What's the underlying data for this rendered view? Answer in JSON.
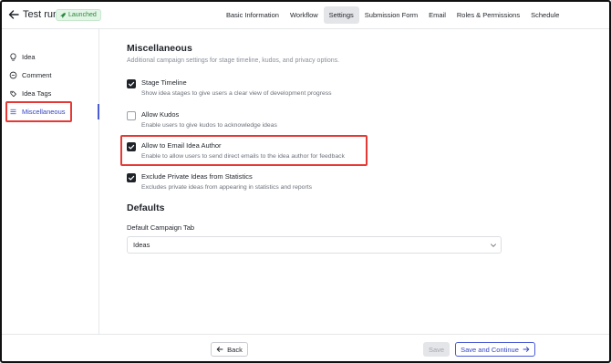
{
  "header": {
    "title": "Test run",
    "badge": "Launched",
    "tabs": [
      {
        "label": "Basic Information",
        "active": false
      },
      {
        "label": "Workflow",
        "active": false
      },
      {
        "label": "Settings",
        "active": true
      },
      {
        "label": "Submission Form",
        "active": false
      },
      {
        "label": "Email",
        "active": false
      },
      {
        "label": "Roles & Permissions",
        "active": false
      },
      {
        "label": "Schedule",
        "active": false
      }
    ]
  },
  "sidebar": {
    "items": [
      {
        "label": "Idea",
        "icon": "bulb-icon"
      },
      {
        "label": "Comment",
        "icon": "comment-icon"
      },
      {
        "label": "Idea Tags",
        "icon": "tag-icon"
      },
      {
        "label": "Miscellaneous",
        "icon": "list-icon",
        "active": true
      }
    ]
  },
  "main": {
    "title": "Miscellaneous",
    "subtitle": "Additional campaign settings for stage timeline, kudos, and privacy options.",
    "options": [
      {
        "title": "Stage Timeline",
        "desc": "Show idea stages to give users a clear view of development progress",
        "checked": true
      },
      {
        "title": "Allow Kudos",
        "desc": "Enable users to give kudos to acknowledge ideas",
        "checked": false
      },
      {
        "title": "Allow to Email Idea Author",
        "desc": "Enable to allow users to send direct emails to the idea author for feedback",
        "checked": true
      },
      {
        "title": "Exclude Private Ideas from Statistics",
        "desc": "Excludes private ideas from appearing in statistics and reports",
        "checked": true
      }
    ],
    "defaults_title": "Defaults",
    "default_tab_label": "Default Campaign Tab",
    "default_tab_value": "Ideas"
  },
  "footer": {
    "back": "Back",
    "save": "Save",
    "continue": "Save and Continue"
  },
  "colors": {
    "accent": "#3345c4",
    "highlight": "#e53935",
    "badge_bg": "#e3f5e6",
    "badge_text": "#2b8a3e"
  }
}
